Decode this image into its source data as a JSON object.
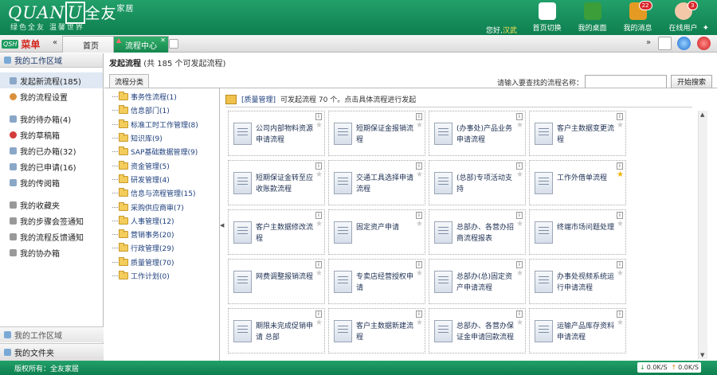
{
  "brand": {
    "logo_text": "QUAN",
    "logo_box": "U",
    "logo_cn": "全友",
    "logo_sub": "家居",
    "slogan": "绿色全友  温馨世界"
  },
  "header": {
    "welcome_prefix": "您好,",
    "welcome_user": "汉武",
    "nav": [
      {
        "label": "首页切换",
        "icon": "home-icon"
      },
      {
        "label": "我的桌面",
        "icon": "desktop-icon"
      },
      {
        "label": "我的消息",
        "icon": "mail-icon",
        "badge": "22"
      },
      {
        "label": "在线用户",
        "icon": "users-icon",
        "badge": "3"
      }
    ],
    "pin_icon": "pin-icon"
  },
  "tabbar": {
    "menu_label": "菜单",
    "tabs": [
      {
        "label": "首页"
      },
      {
        "label": "流程中心"
      }
    ]
  },
  "sidebar": {
    "title": "我的工作区域",
    "items": [
      {
        "label": "发起新流程(185)",
        "active": true
      },
      {
        "label": "我的流程设置"
      },
      {
        "label": "我的待办箱(4)"
      },
      {
        "label": "我的草稿箱"
      },
      {
        "label": "我的已办箱(32)"
      },
      {
        "label": "我的已申请(16)"
      },
      {
        "label": "我的传阅箱"
      },
      {
        "label": "我的收藏夹"
      },
      {
        "label": "我的步骤会签通知"
      },
      {
        "label": "我的流程反馈通知"
      },
      {
        "label": "我的协办箱"
      }
    ],
    "footer1": "我的工作区域",
    "footer2": "我的文件夹"
  },
  "main": {
    "title": "发起流程",
    "count_text": "(共 185 个可发起流程)",
    "sort_tab": "流程分类",
    "search_label": "请输入要查找的流程名称：",
    "search_value": "",
    "search_button": "开始搜索",
    "folders": [
      "事务性流程(1)",
      "信息部门(1)",
      "标准工时工作管理(8)",
      "知识库(9)",
      "SAP基础数据管理(9)",
      "资金管理(5)",
      "研发管理(4)",
      "信息与流程管理(15)",
      "采购供应商审(7)",
      "人事管理(12)",
      "营销事务(20)",
      "行政管理(29)",
      "质量管理(70)",
      "工作计划(0)"
    ],
    "info_tag": "[质量管理]",
    "info_text": "可发起流程 70 个。点击具体流程进行发起",
    "processes": [
      {
        "name": "公司内部物料资源申请流程",
        "starred": false
      },
      {
        "name": "短期保证金报销流程",
        "starred": false
      },
      {
        "name": "(办事处)产品业务申请流程",
        "starred": false
      },
      {
        "name": "客户主数据变更流程",
        "starred": false
      },
      {
        "name": "短期保证金转至应收账款流程",
        "starred": false
      },
      {
        "name": "交通工具选择申请流程",
        "starred": false
      },
      {
        "name": "(总部)专项活动支持",
        "starred": false
      },
      {
        "name": "工作外借单流程",
        "starred": true
      },
      {
        "name": "客户主数据修改流程",
        "starred": false
      },
      {
        "name": "固定资产申请",
        "starred": false
      },
      {
        "name": "总部办、各营办招商流程报表",
        "starred": false
      },
      {
        "name": "终端市场问题处理",
        "starred": false
      },
      {
        "name": "网费调整报销流程",
        "starred": false
      },
      {
        "name": "专卖店经营授权申请",
        "starred": false
      },
      {
        "name": "总部办(总)固定资产申请流程",
        "starred": false
      },
      {
        "name": "办事处视频系统运行申请流程",
        "starred": false
      },
      {
        "name": "期限未完成促销申请 总部",
        "starred": false
      },
      {
        "name": "客户主数据新建流程",
        "starred": false
      },
      {
        "name": "总部办、各营办保证金申请回款流程",
        "starred": false
      },
      {
        "name": "运输产品库存资料申请流程",
        "starred": false
      }
    ]
  },
  "statusbar": {
    "copyright": "版权所有：全友家居",
    "down": "0.0K/S",
    "up": "0.0K/S"
  }
}
